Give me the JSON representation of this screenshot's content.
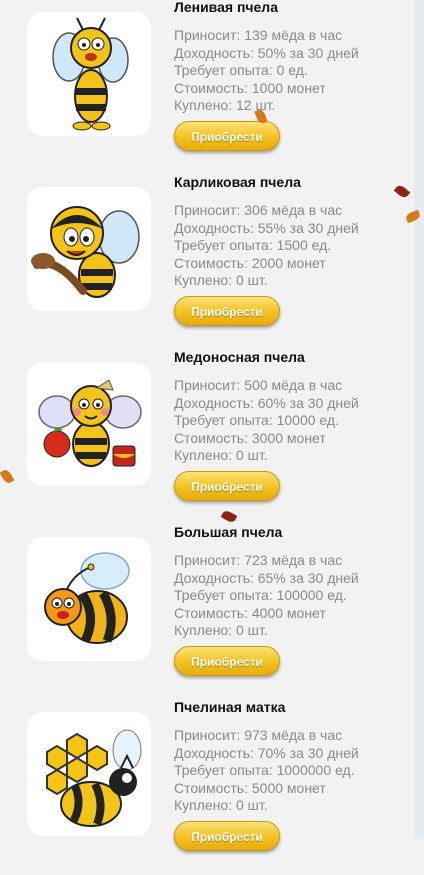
{
  "bees": [
    {
      "name": "Ленивая пчела",
      "stats": [
        "Приносит: 139 мёда в час",
        "Доходность: 50% за 30 дней",
        "Требует опыта: 0 ед.",
        "Стоимость: 1000 монет",
        "Куплено: 12 шт."
      ],
      "button": "Приобрести",
      "icon": "lazy-bee-icon"
    },
    {
      "name": "Карликовая пчела",
      "stats": [
        "Приносит: 306 мёда в час",
        "Доходность: 55% за 30 дней",
        "Требует опыта: 1500 ед.",
        "Стоимость: 2000 монет",
        "Куплено: 0 шт."
      ],
      "button": "Приобрести",
      "icon": "dwarf-bee-icon"
    },
    {
      "name": "Медоносная пчела",
      "stats": [
        "Приносит: 500 мёда в час",
        "Доходность: 60% за 30 дней",
        "Требует опыта: 10000 ед.",
        "Стоимость: 3000 монет",
        "Куплено: 0 шт."
      ],
      "button": "Приобрести",
      "icon": "honey-bee-icon"
    },
    {
      "name": "Большая пчела",
      "stats": [
        "Приносит: 723 мёда в час",
        "Доходность: 65% за 30 дней",
        "Требует опыта: 100000 ед.",
        "Стоимость: 4000 монет",
        "Куплено: 0 шт."
      ],
      "button": "Приобрести",
      "icon": "big-bee-icon"
    },
    {
      "name": "Пчелиная матка",
      "stats": [
        "Приносит: 973 мёда в час",
        "Доходность: 70% за 30 дней",
        "Требует опыта: 1000000 ед.",
        "Стоимость: 5000 монет",
        "Куплено: 0 шт."
      ],
      "button": "Приобрести",
      "icon": "queen-bee-icon"
    }
  ],
  "colors": {
    "button": "#f3c21f",
    "stat_text": "#8a8a8a",
    "title_text": "#111111",
    "background": "#f2f2f2"
  }
}
